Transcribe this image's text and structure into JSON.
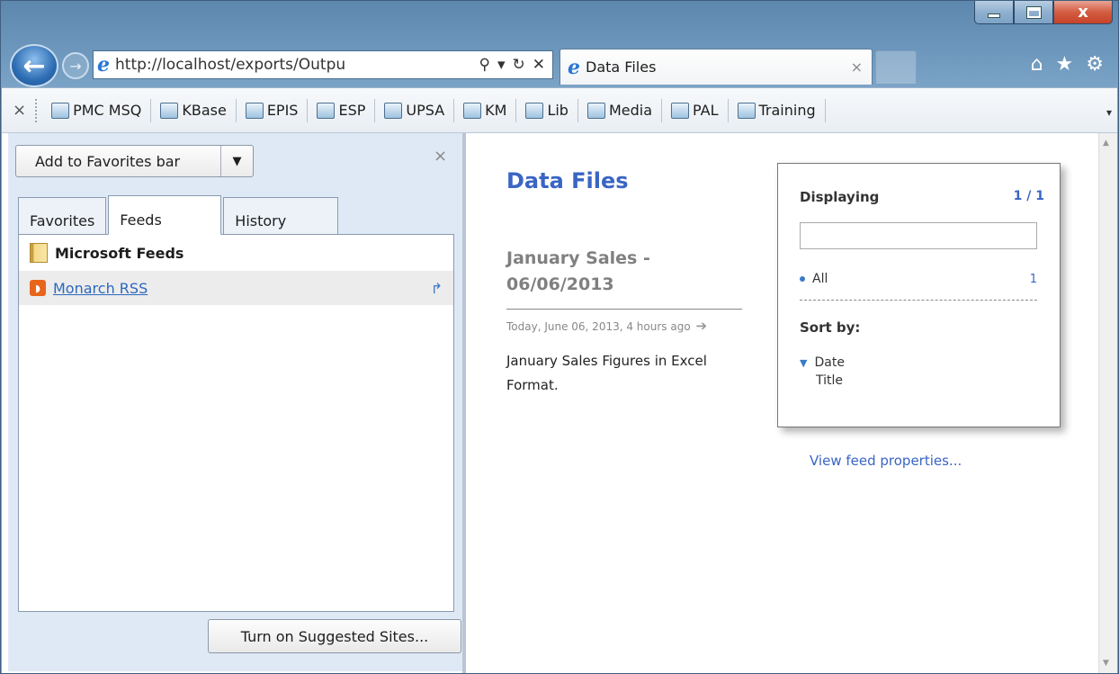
{
  "window": {
    "caption_close": "x"
  },
  "nav": {
    "back": "←",
    "forward": "→",
    "address": "http://localhost/exports/Outpu",
    "tab_title": "Data Files",
    "tab_close": "×"
  },
  "favorites_bar": {
    "close": "×",
    "items": [
      {
        "label": "PMC MSQ"
      },
      {
        "label": "KBase"
      },
      {
        "label": "EPIS"
      },
      {
        "label": "ESP"
      },
      {
        "label": "UPSA"
      },
      {
        "label": "KM"
      },
      {
        "label": "Lib"
      },
      {
        "label": "Media"
      },
      {
        "label": "PAL"
      },
      {
        "label": "Training"
      }
    ]
  },
  "pane": {
    "add_favorites": "Add to Favorites bar",
    "close": "×",
    "tabs": [
      "Favorites",
      "Feeds",
      "History"
    ],
    "folder": "Microsoft Feeds",
    "feed": "Monarch RSS",
    "suggested": "Turn on Suggested Sites..."
  },
  "content": {
    "page_title": "Data Files",
    "item_title": "January Sales - 06/06/2013",
    "item_date": "Today, June 06, 2013, 4 hours ago",
    "item_desc": "January Sales Figures in Excel Format.",
    "displaying": "Displaying",
    "displaying_count": "1 / 1",
    "all_label": "All",
    "all_count": "1",
    "sort_by": "Sort by:",
    "sort_date": "Date",
    "sort_title": "Title",
    "view_props": "View feed properties..."
  },
  "colors": {
    "accent": "#3a65c4",
    "link": "#2d68bd"
  }
}
